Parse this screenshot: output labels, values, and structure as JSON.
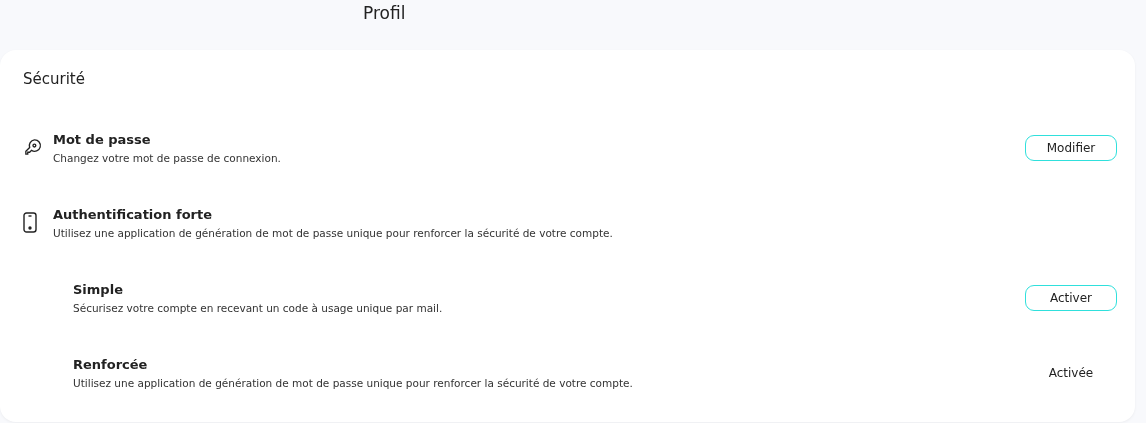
{
  "header": {
    "title": "Profil"
  },
  "section": {
    "title": "Sécurité",
    "items": [
      {
        "title": "Mot de passe",
        "description": "Changez votre mot de passe de connexion.",
        "action": {
          "kind": "button",
          "label": "Modifier"
        }
      },
      {
        "title": "Authentification forte",
        "description": "Utilisez une application de génération de mot de passe unique pour renforcer la sécurité de votre compte.",
        "children": [
          {
            "title": "Simple",
            "description": "Sécurisez votre compte en recevant un code à usage unique par mail.",
            "action": {
              "kind": "button",
              "label": "Activer"
            }
          },
          {
            "title": "Renforcée",
            "description": "Utilisez une application de génération de mot de passe unique pour renforcer la sécurité de votre compte.",
            "action": {
              "kind": "status",
              "label": "Activée"
            }
          }
        ]
      }
    ]
  }
}
